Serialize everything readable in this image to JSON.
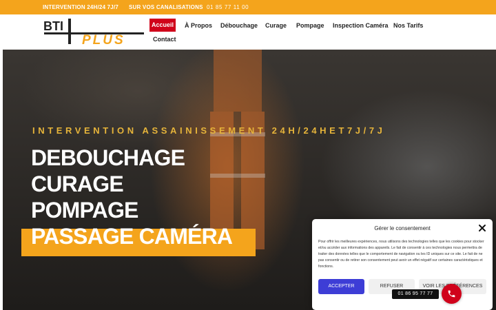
{
  "topbar": {
    "intervention": "INTERVENTION 24H/24 7J/7",
    "canalisations": "SUR VOS CANALISATIONS",
    "phone": "01 85 77 11 00"
  },
  "logo": {
    "text_top": "BTI",
    "text_bottom": "PLUS",
    "colors": {
      "dark": "#222222",
      "accent": "#f4a41c"
    }
  },
  "nav": {
    "items": [
      "Accueil",
      "À Propos",
      "Débouchage",
      "Curage",
      "Pompage",
      "Inspection Caméra",
      "Nos Tarifs",
      "Contact"
    ],
    "active": "Accueil",
    "active_color": "#d0021b"
  },
  "hero": {
    "subtitle": "INTERVENTION ASSAINISSEMENT 24H/24HET7J/7J",
    "lines": [
      "DEBOUCHAGE",
      "CURAGE",
      "POMPAGE",
      "PASSAGE CAMÉRA"
    ],
    "highlight_color": "#f4a41c"
  },
  "consent": {
    "title": "Gérer le consentement",
    "text": "Pour offrir les meilleures expériences, nous utilisons des technologies telles que les cookies pour stocker et/ou accéder aux informations des appareils. Le fait de consentir à ces technologies nous permettra de traiter des données telles que le comportement de navigation ou les ID uniques sur ce site. Le fait de ne pas consentir ou de retirer son consentement peut avoir un effet négatif sur certaines caractéristiques et fonctions.",
    "accept": "ACCEPTER",
    "refuse": "REFUSER",
    "preferences": "VOIR LES PRÉFÉRENCES",
    "close_icon": "close-icon"
  },
  "floating_phone": {
    "number": "01 86 95 77 77",
    "icon": "phone-icon",
    "color": "#d0021b"
  }
}
